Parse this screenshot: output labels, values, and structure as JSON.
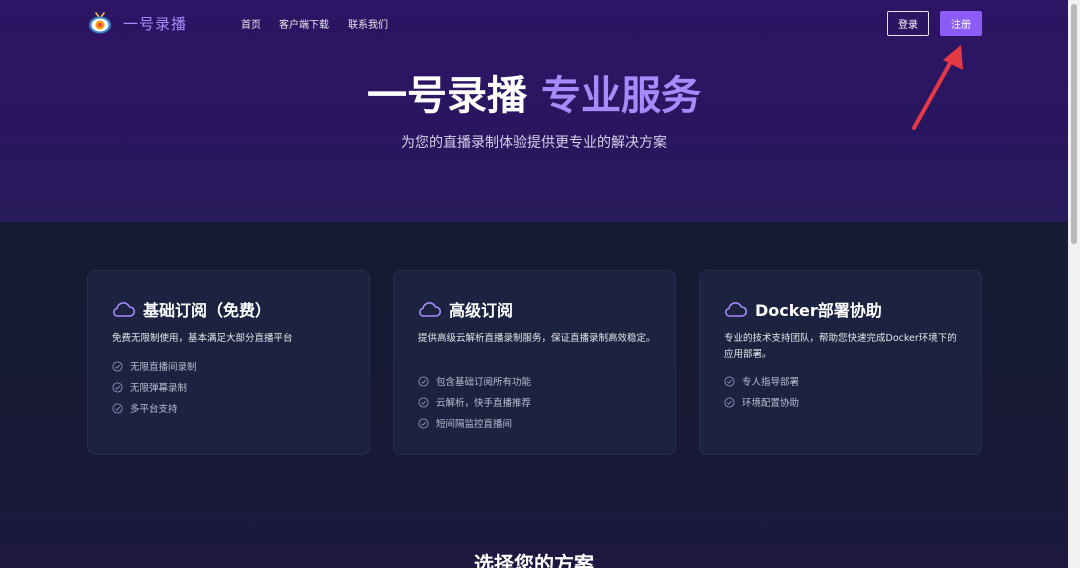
{
  "nav": {
    "brand": "一号录播",
    "links": [
      "首页",
      "客户端下载",
      "联系我们"
    ],
    "login_label": "登录",
    "register_label": "注册"
  },
  "hero": {
    "title_white": "一号录播",
    "title_accent": "专业服务",
    "subtitle": "为您的直播录制体验提供更专业的解决方案"
  },
  "plans": [
    {
      "title": "基础订阅（免费）",
      "icon": "cloud-icon",
      "description": "免费无限制使用，基本满足大部分直播平台",
      "features": [
        "无限直播间录制",
        "无限弹幕录制",
        "多平台支持"
      ]
    },
    {
      "title": "高级订阅",
      "icon": "cloud-icon",
      "description": "提供高级云解析直播录制服务，保证直播录制高效稳定。",
      "features": [
        "包含基础订阅所有功能",
        "云解析，快手直播推荐",
        "短间隔监控直播间"
      ]
    },
    {
      "title": "Docker部署协助",
      "icon": "cloud-icon",
      "description": "专业的技术支持团队，帮助您快速完成Docker环境下的应用部署。",
      "features": [
        "专人指导部署",
        "环境配置协助"
      ]
    }
  ],
  "section": {
    "title": "选择您的方案"
  },
  "colors": {
    "accent": "#a78bfa",
    "button": "#8b5cf6",
    "annotation_arrow": "#e53945",
    "hero_bg": "#2e1464",
    "content_bg": "#151b33",
    "card_bg": "#1c2340"
  }
}
